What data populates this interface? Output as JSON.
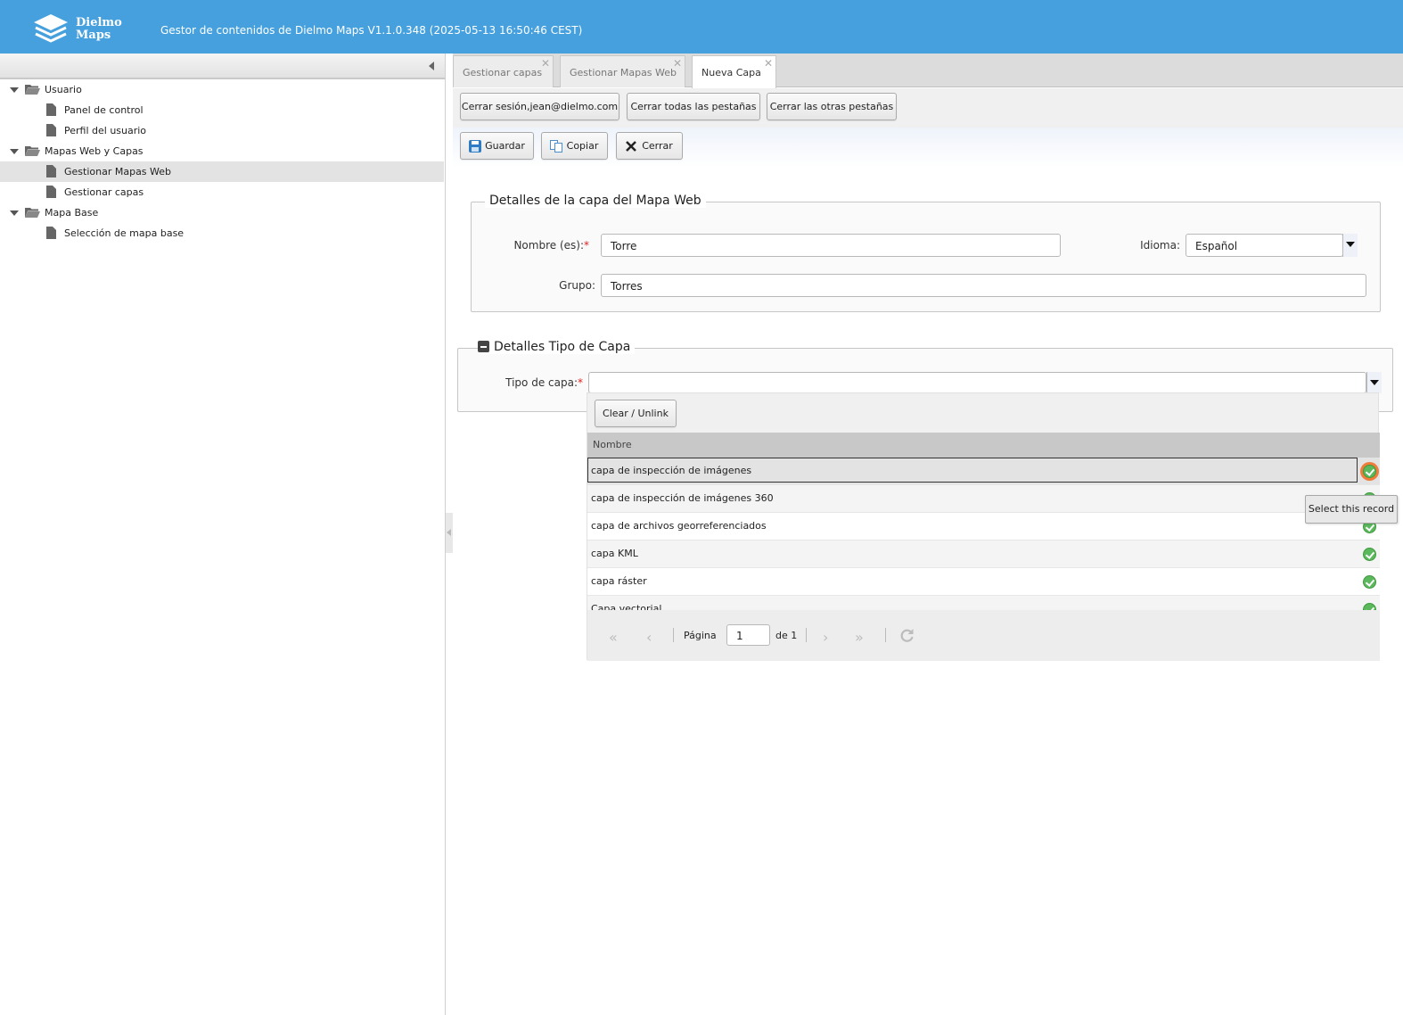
{
  "header": {
    "logo_line1": "Dielmo",
    "logo_line2": "Maps",
    "title": "Gestor de contenidos de Dielmo Maps V1.1.0.348 (2025-05-13 16:50:46 CEST)"
  },
  "sidebar": {
    "groups": [
      {
        "label": "Usuario",
        "items": [
          "Panel de control",
          "Perfil del usuario"
        ]
      },
      {
        "label": "Mapas Web y Capas",
        "items": [
          "Gestionar Mapas Web",
          "Gestionar capas"
        ]
      },
      {
        "label": "Mapa Base",
        "items": [
          "Selección de mapa base"
        ]
      }
    ],
    "selected_item": "Gestionar Mapas Web"
  },
  "tabs": [
    {
      "label": "Gestionar capas",
      "active": false
    },
    {
      "label": "Gestionar Mapas Web",
      "active": false
    },
    {
      "label": "Nueva Capa",
      "active": true
    }
  ],
  "session_buttons": {
    "logout": "Cerrar sesión,jean@dielmo.com",
    "close_all": "Cerrar todas las pestañas",
    "close_others": "Cerrar las otras pestañas"
  },
  "toolbar": {
    "save": "Guardar",
    "copy": "Copiar",
    "close": "Cerrar"
  },
  "layer_details": {
    "legend": "Detalles de la capa del Mapa Web",
    "name_label": "Nombre (es):",
    "name_value": "Torre",
    "language_label": "Idioma:",
    "language_value": "Español",
    "group_label": "Grupo:",
    "group_value": "Torres",
    "required_mark": "*"
  },
  "layer_type": {
    "legend": "Detalles Tipo de Capa",
    "type_label": "Tipo de capa:",
    "type_value": "",
    "required_mark": "*"
  },
  "picker": {
    "clear_button": "Clear / Unlink",
    "column_header": "Nombre",
    "rows": [
      "capa de inspección de imágenes",
      "capa de inspección de imágenes 360",
      "capa de archivos georreferenciados",
      "capa KML",
      "capa ráster",
      "Capa vectorial"
    ],
    "selected_row": 0,
    "pager": {
      "page_label": "Página",
      "page_value": "1",
      "of_label": "de 1"
    },
    "tooltip": "Select this record"
  },
  "colors": {
    "header_bg": "#45a0dd",
    "select_icon": "#5cb85c",
    "select_highlight": "#f07b3b",
    "required": "#e02020"
  }
}
